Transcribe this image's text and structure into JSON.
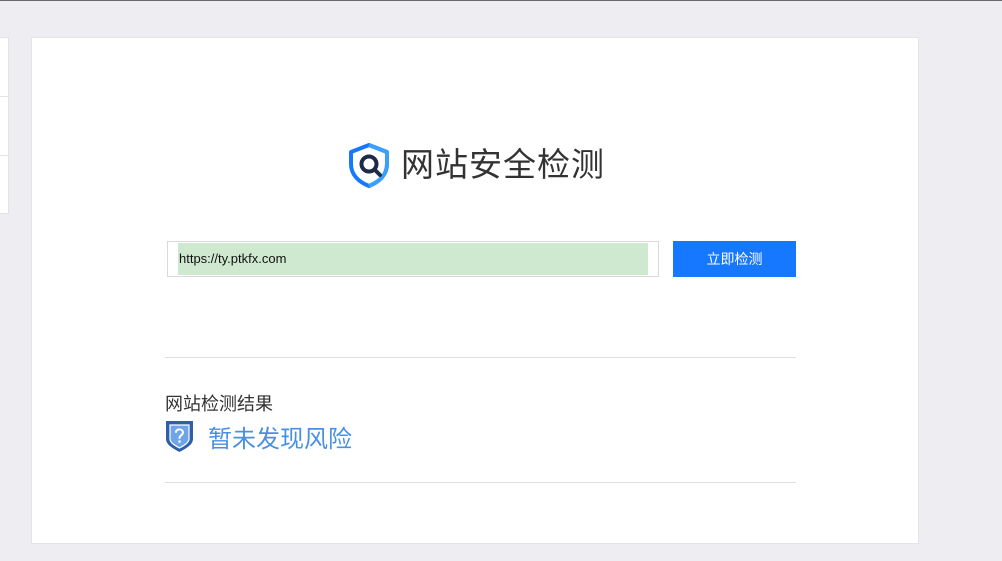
{
  "header": {
    "title": "网站安全检测",
    "logo_icon": "shield-search-icon"
  },
  "scan": {
    "url_value": "https://ty.ptkfx.com",
    "button_label": "立即检测"
  },
  "result": {
    "label": "网站检测结果",
    "status": "暂未发现风险",
    "status_icon": "shield-question-icon",
    "status_color": "#4a90e2"
  },
  "colors": {
    "accent": "#1677ff",
    "background": "#eeeef2",
    "input_highlight": "#cfe8d0"
  }
}
